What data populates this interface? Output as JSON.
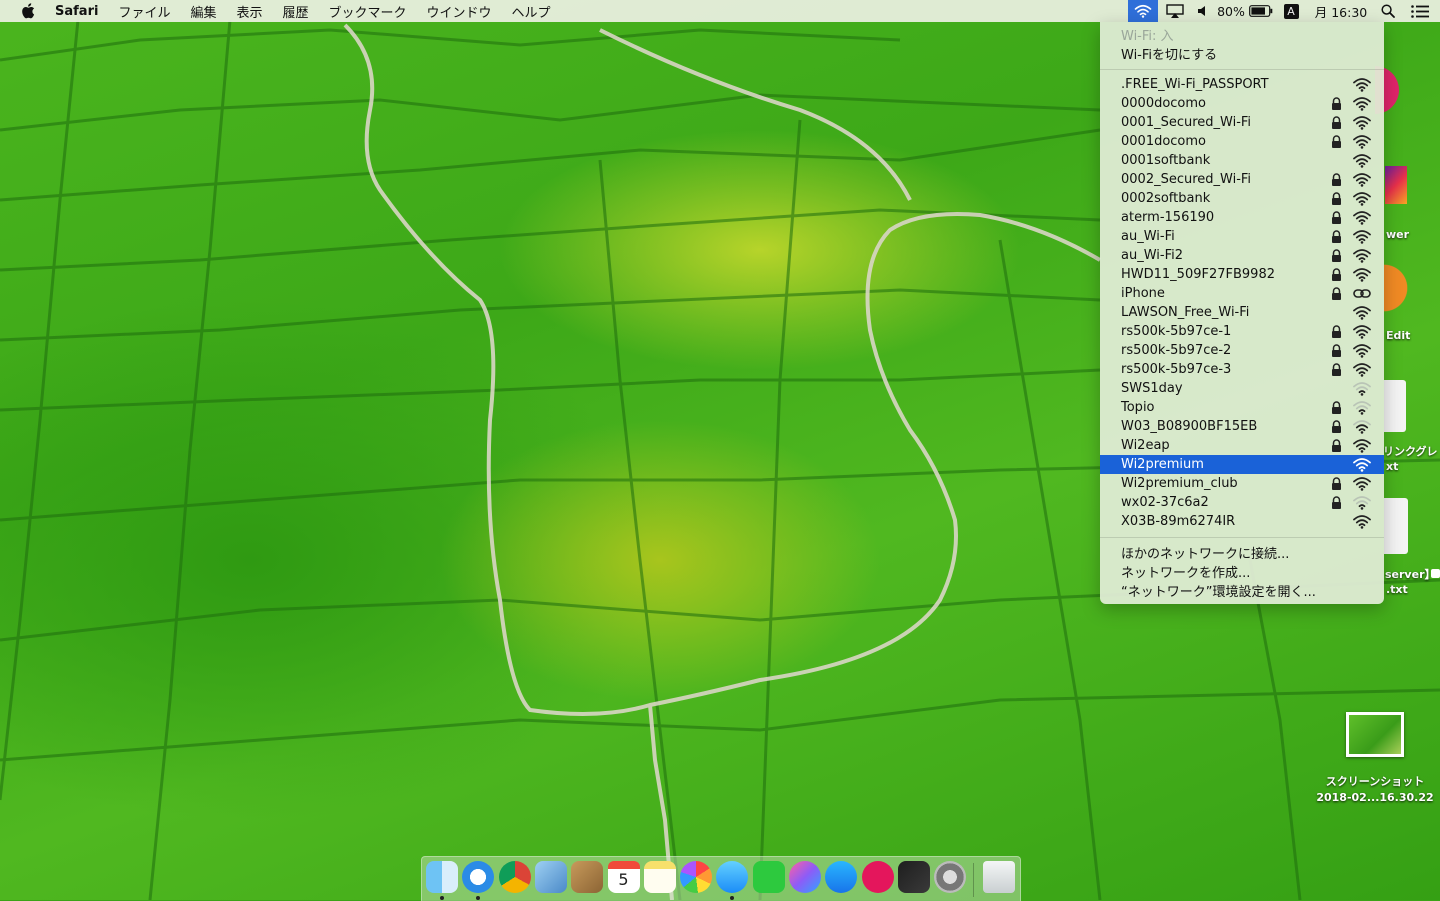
{
  "menubar": {
    "apple_icon": "apple-icon",
    "app_name": "Safari",
    "items": [
      "ファイル",
      "編集",
      "表示",
      "履歴",
      "ブックマーク",
      "ウインドウ",
      "ヘルプ"
    ],
    "status": {
      "battery_percent": "80%",
      "input_source": "A",
      "clock": "月 16:30"
    }
  },
  "wifi_menu": {
    "status_label": "Wi-Fi: 入",
    "toggle_label": "Wi-Fiを切にする",
    "networks": [
      {
        "name": ".FREE_Wi-Fi_PASSPORT",
        "locked": false,
        "signal": "full"
      },
      {
        "name": "0000docomo",
        "locked": true,
        "signal": "full"
      },
      {
        "name": "0001_Secured_Wi-Fi",
        "locked": true,
        "signal": "full"
      },
      {
        "name": "0001docomo",
        "locked": true,
        "signal": "full"
      },
      {
        "name": "0001softbank",
        "locked": false,
        "signal": "full"
      },
      {
        "name": "0002_Secured_Wi-Fi",
        "locked": true,
        "signal": "full"
      },
      {
        "name": "0002softbank",
        "locked": true,
        "signal": "full"
      },
      {
        "name": "aterm-156190",
        "locked": true,
        "signal": "full"
      },
      {
        "name": "au_Wi-Fi",
        "locked": true,
        "signal": "full"
      },
      {
        "name": "au_Wi-Fi2",
        "locked": true,
        "signal": "full"
      },
      {
        "name": "HWD11_509F27FB9982",
        "locked": true,
        "signal": "full"
      },
      {
        "name": "iPhone",
        "locked": true,
        "signal": "hotspot"
      },
      {
        "name": "LAWSON_Free_Wi-Fi",
        "locked": false,
        "signal": "full"
      },
      {
        "name": "rs500k-5b97ce-1",
        "locked": true,
        "signal": "full"
      },
      {
        "name": "rs500k-5b97ce-2",
        "locked": true,
        "signal": "full"
      },
      {
        "name": "rs500k-5b97ce-3",
        "locked": true,
        "signal": "full"
      },
      {
        "name": "SWS1day",
        "locked": false,
        "signal": "weak"
      },
      {
        "name": "Topio",
        "locked": true,
        "signal": "weak"
      },
      {
        "name": "W03_B08900BF15EB",
        "locked": true,
        "signal": "medium"
      },
      {
        "name": "Wi2eap",
        "locked": true,
        "signal": "full"
      },
      {
        "name": "Wi2premium",
        "locked": false,
        "signal": "full",
        "selected": true
      },
      {
        "name": "Wi2premium_club",
        "locked": true,
        "signal": "full"
      },
      {
        "name": "wx02-37c6a2",
        "locked": true,
        "signal": "weak"
      },
      {
        "name": "X03B-89m6274IR",
        "locked": false,
        "signal": "full"
      }
    ],
    "actions": [
      "ほかのネットワークに接続...",
      "ネットワークを作成...",
      "“ネットワーク”環境設定を開く..."
    ]
  },
  "desktop": {
    "screenshot_label_line1": "スクリーンショット",
    "screenshot_label_line2": "2018-02...16.30.22",
    "peek_labels": [
      "wer",
      "Edit",
      "リンクグレ",
      "xt",
      "server】",
      ".txt"
    ]
  },
  "dock": {
    "apps": [
      {
        "name": "finder-icon",
        "running": true
      },
      {
        "name": "safari-icon",
        "running": true
      },
      {
        "name": "chrome-icon",
        "running": false
      },
      {
        "name": "preview-icon",
        "running": false
      },
      {
        "name": "contacts-icon",
        "running": false
      },
      {
        "name": "calendar-icon",
        "running": false,
        "day": "5"
      },
      {
        "name": "notes-icon",
        "running": false
      },
      {
        "name": "photos-icon",
        "running": false
      },
      {
        "name": "messages-icon",
        "running": true
      },
      {
        "name": "line-icon",
        "running": false
      },
      {
        "name": "itunes-icon",
        "running": false
      },
      {
        "name": "app-store-icon",
        "running": false
      },
      {
        "name": "airmail-icon",
        "running": false
      },
      {
        "name": "monitor-app-icon",
        "running": false
      },
      {
        "name": "system-preferences-icon",
        "running": false
      },
      {
        "name": "trash-icon",
        "running": false
      }
    ]
  }
}
